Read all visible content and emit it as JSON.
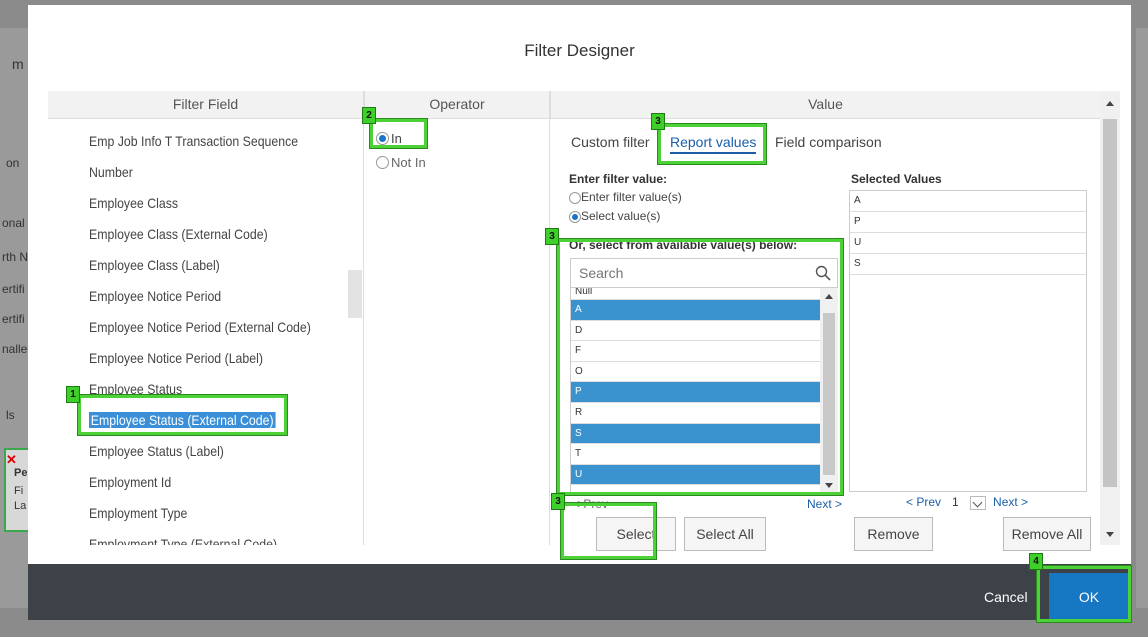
{
  "background": {
    "fragments": [
      "m",
      "on",
      "onal",
      "rth N",
      "ertifi",
      "ertifi",
      "nalle",
      "ls",
      "Pe",
      "Fi",
      "La"
    ]
  },
  "dialog": {
    "title": "Filter Designer",
    "columns": {
      "field": "Filter Field",
      "operator": "Operator",
      "value": "Value"
    }
  },
  "field_list": {
    "items": [
      "Emp Job Info T Transaction Sequence",
      "Number",
      "Employee Class",
      "Employee Class (External Code)",
      "Employee Class (Label)",
      "Employee Notice Period",
      "Employee Notice Period (External Code)",
      "Employee Notice Period (Label)",
      "Employee Status",
      "Employee Status (External Code)",
      "Employee Status (Label)",
      "Employment Id",
      "Employment Type",
      "Employment Type (External Code)"
    ],
    "selected_index": 9
  },
  "operator": {
    "options": [
      "In",
      "Not In"
    ],
    "selected": "In"
  },
  "value": {
    "tabs": [
      "Custom filter",
      "Report values",
      "Field comparison"
    ],
    "active_tab": "Report values",
    "enter_label": "Enter filter value:",
    "mode_options": [
      "Enter filter value(s)",
      "Select value(s)"
    ],
    "mode_selected": "Select value(s)",
    "or_label": "Or, select from available value(s) below:",
    "search_placeholder": "Search",
    "available": [
      "Null",
      "A",
      "D",
      "F",
      "O",
      "P",
      "R",
      "S",
      "T",
      "U"
    ],
    "available_selected": [
      "A",
      "P",
      "S",
      "U"
    ],
    "pager_prev": "< Prev",
    "pager_next": "Next >",
    "select_button": "Select",
    "select_all_button": "Select All",
    "selected_label": "Selected Values",
    "selected_values": [
      "A",
      "P",
      "U",
      "S"
    ],
    "right_pager": {
      "prev": "< Prev",
      "page": "1",
      "next": "Next >"
    },
    "remove_button": "Remove",
    "remove_all_button": "Remove All"
  },
  "footer": {
    "cancel": "Cancel",
    "ok": "OK"
  },
  "annotations": {
    "badges": [
      "1",
      "2",
      "3",
      "3",
      "3",
      "4"
    ],
    "highlight_color": "#4cd137"
  },
  "colors": {
    "selection_blue": "#3a93cf",
    "ok_blue": "#1677c2",
    "footer_bg": "#3d4148",
    "link_blue": "#1a5fa8"
  }
}
